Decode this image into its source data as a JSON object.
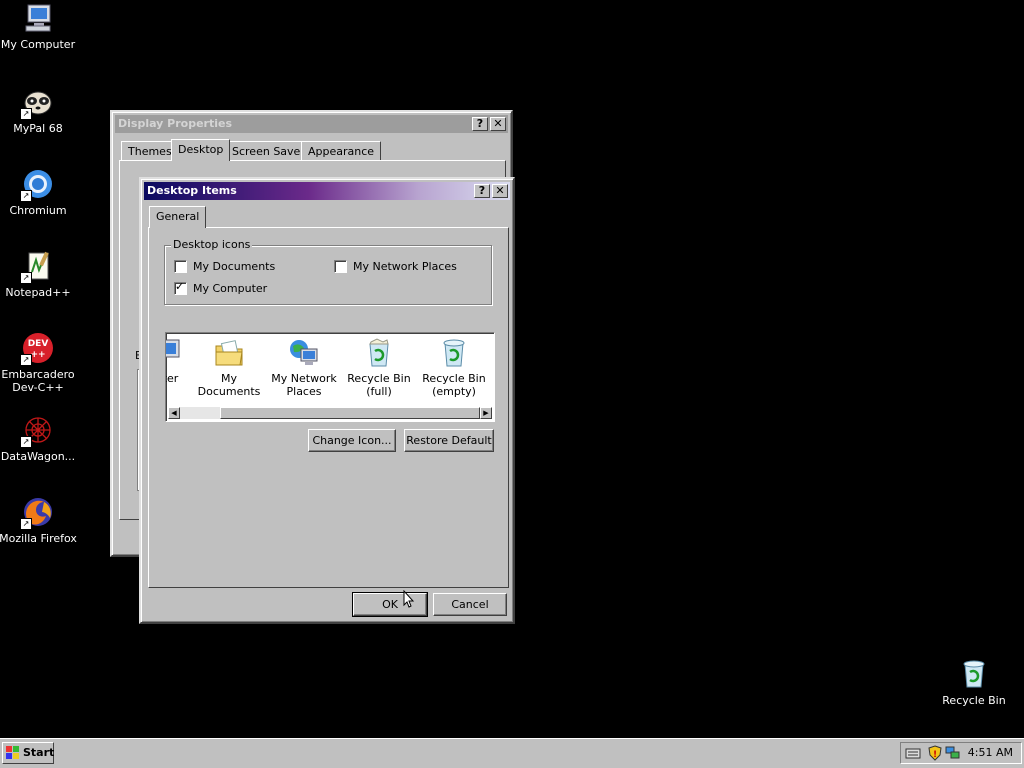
{
  "desktop": {
    "icons": [
      {
        "label": "My Computer",
        "icon": "computer-icon"
      },
      {
        "label": "MyPal 68",
        "icon": "mypal-icon"
      },
      {
        "label": "Chromium",
        "icon": "chromium-icon"
      },
      {
        "label": "Notepad++",
        "icon": "notepad-icon"
      },
      {
        "label": "Embarcadero Dev-C++",
        "icon": "devcpp-icon"
      },
      {
        "label": "DataWagon...",
        "icon": "datawagon-icon"
      },
      {
        "label": "Mozilla Firefox",
        "icon": "firefox-icon"
      },
      {
        "label": "Recycle Bin",
        "icon": "recycle-bin-icon"
      }
    ]
  },
  "display_properties": {
    "title": "Display Properties",
    "help_label": "?",
    "close_label": "✕",
    "tabs": [
      "Themes",
      "Desktop",
      "Screen Saver",
      "Appearance"
    ],
    "selected_tab": "Desktop",
    "partial_label": "B"
  },
  "desktop_items": {
    "title": "Desktop Items",
    "help_label": "?",
    "close_label": "✕",
    "tab": "General",
    "group_label": "Desktop icons",
    "checkboxes": [
      {
        "label": "My Documents",
        "checked": false
      },
      {
        "label": "My Network Places",
        "checked": false
      },
      {
        "label": "My Computer",
        "checked": true
      }
    ],
    "icon_list": [
      {
        "label": "uter",
        "icon": "computer-icon"
      },
      {
        "label": "My Documents",
        "icon": "folder-documents-icon"
      },
      {
        "label": "My Network Places",
        "icon": "network-places-icon"
      },
      {
        "label": "Recycle Bin (full)",
        "icon": "recycle-bin-full-icon"
      },
      {
        "label": "Recycle Bin (empty)",
        "icon": "recycle-bin-empty-icon"
      }
    ],
    "change_icon_label": "Change Icon...",
    "restore_default_label": "Restore Default",
    "ok_label": "OK",
    "cancel_label": "Cancel"
  },
  "taskbar": {
    "start_label": "Start",
    "clock": "4:51 AM",
    "tray_icons": [
      "keyboard-icon",
      "security-shield-icon",
      "network-icon"
    ]
  },
  "colors": {
    "desktop_bg": "#000000",
    "face": "#c0c0c0",
    "active_title_start": "#0a0a60",
    "active_title_end": "#dadcf0",
    "inactive_title": "#9d9d9d"
  }
}
